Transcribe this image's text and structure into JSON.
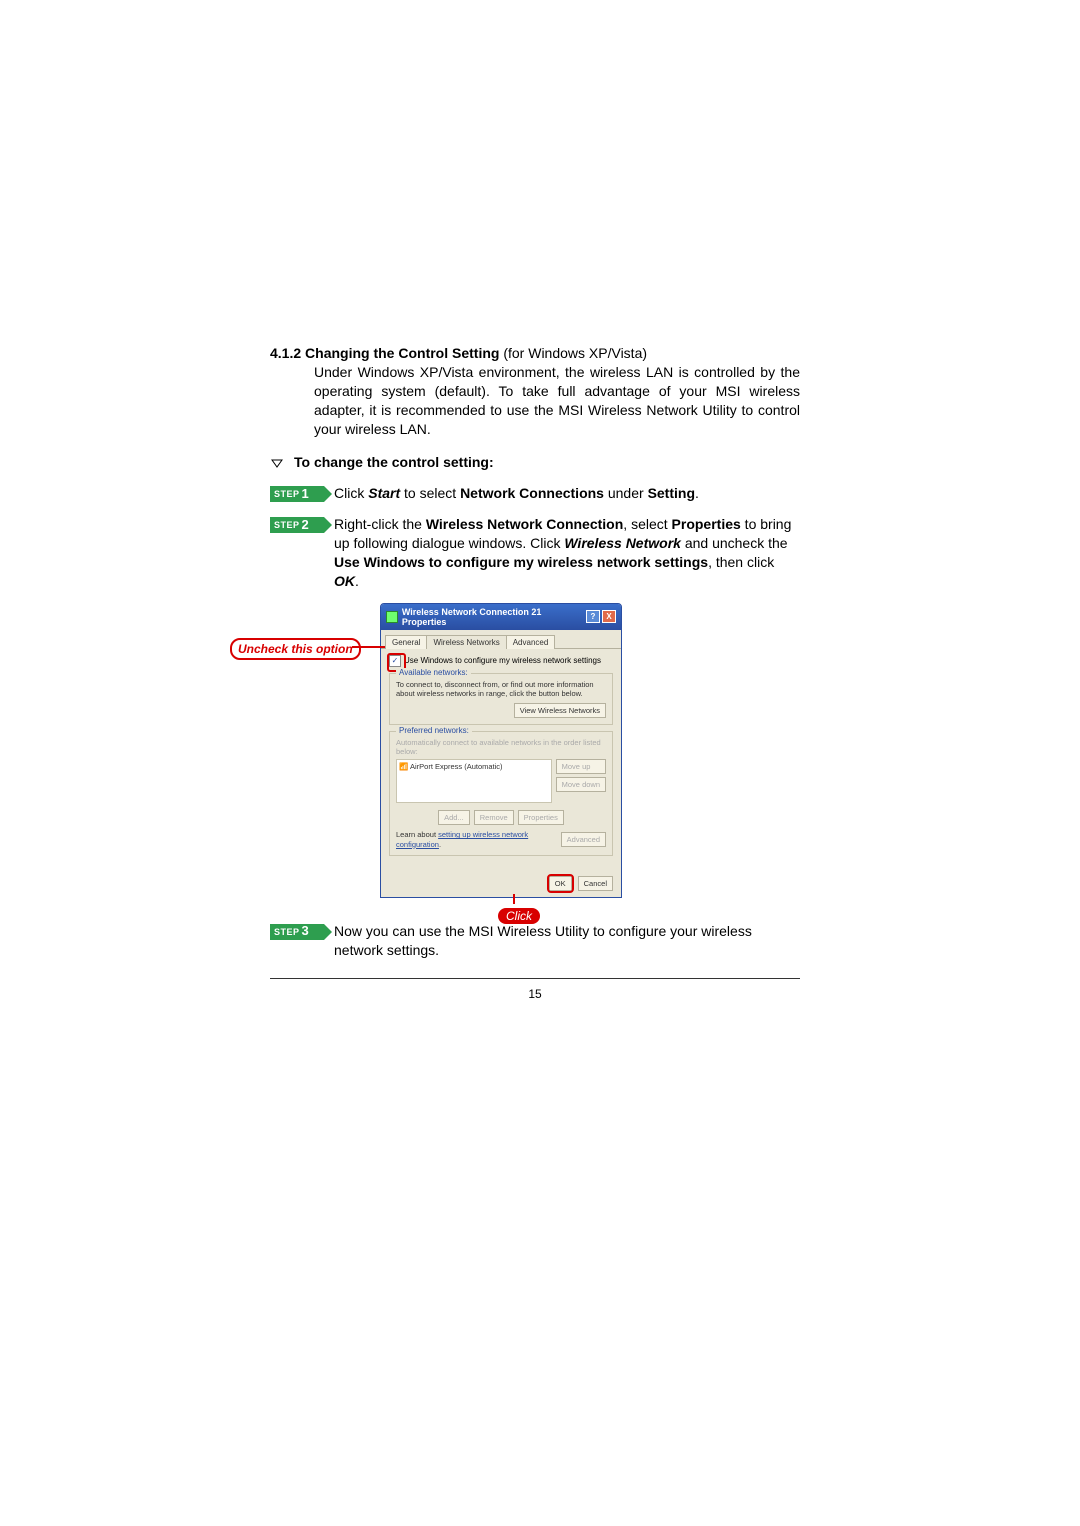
{
  "section": {
    "number": "4.1.2",
    "title": "Changing the Control Setting",
    "title_suffix": " (for Windows XP/Vista)",
    "intro": "Under Windows XP/Vista environment, the wireless LAN is controlled by the operating system (default).  To take full advantage of your MSI wireless adapter, it is recommended to use the MSI Wireless Network Utility to control your wireless LAN."
  },
  "subheader": "To change the control setting:",
  "steps": [
    {
      "badge": "STEP",
      "num": "1",
      "parts": [
        {
          "t": "plain",
          "v": "Click "
        },
        {
          "t": "ibold",
          "v": "Start"
        },
        {
          "t": "plain",
          "v": " to select "
        },
        {
          "t": "bold",
          "v": "Network Connections"
        },
        {
          "t": "plain",
          "v": " under "
        },
        {
          "t": "bold",
          "v": "Setting"
        },
        {
          "t": "plain",
          "v": "."
        }
      ]
    },
    {
      "badge": "STEP",
      "num": "2",
      "parts": [
        {
          "t": "plain",
          "v": "Right-click the "
        },
        {
          "t": "bold",
          "v": "Wireless Network Connection"
        },
        {
          "t": "plain",
          "v": ", select "
        },
        {
          "t": "bold",
          "v": "Properties"
        },
        {
          "t": "plain",
          "v": " to bring up following dialogue windows. Click "
        },
        {
          "t": "ibold",
          "v": "Wireless Network"
        },
        {
          "t": "plain",
          "v": " and uncheck the "
        },
        {
          "t": "bold",
          "v": "Use Windows to configure my wireless network settings"
        },
        {
          "t": "plain",
          "v": ", then click "
        },
        {
          "t": "ibold",
          "v": "OK"
        },
        {
          "t": "plain",
          "v": "."
        }
      ]
    },
    {
      "badge": "STEP",
      "num": "3",
      "parts": [
        {
          "t": "plain",
          "v": "Now you can use the MSI Wireless Utility to configure your wireless network settings."
        }
      ]
    }
  ],
  "callouts": {
    "uncheck": "Uncheck this option",
    "click": "Click"
  },
  "dialog": {
    "title": "Wireless Network Connection 21 Properties",
    "help": "?",
    "close": "X",
    "tabs": [
      "General",
      "Wireless Networks",
      "Advanced"
    ],
    "use_windows_label": "Use Windows to configure my wireless network settings",
    "checkmark": "✓",
    "available_legend": "Available networks:",
    "available_text": "To connect to, disconnect from, or find out more information about wireless networks in range, click the button below.",
    "view_btn": "View Wireless Networks",
    "preferred_legend": "Preferred networks:",
    "preferred_text": "Automatically connect to available networks in the order listed below:",
    "preferred_item": "AirPort Express (Automatic)",
    "move_up": "Move up",
    "move_down": "Move down",
    "add": "Add...",
    "remove": "Remove",
    "properties": "Properties",
    "learn_text": "Learn about ",
    "learn_link": "setting up wireless network configuration",
    "learn_period": ".",
    "advanced_btn": "Advanced",
    "ok": "OK",
    "cancel": "Cancel"
  },
  "page_number": "15"
}
